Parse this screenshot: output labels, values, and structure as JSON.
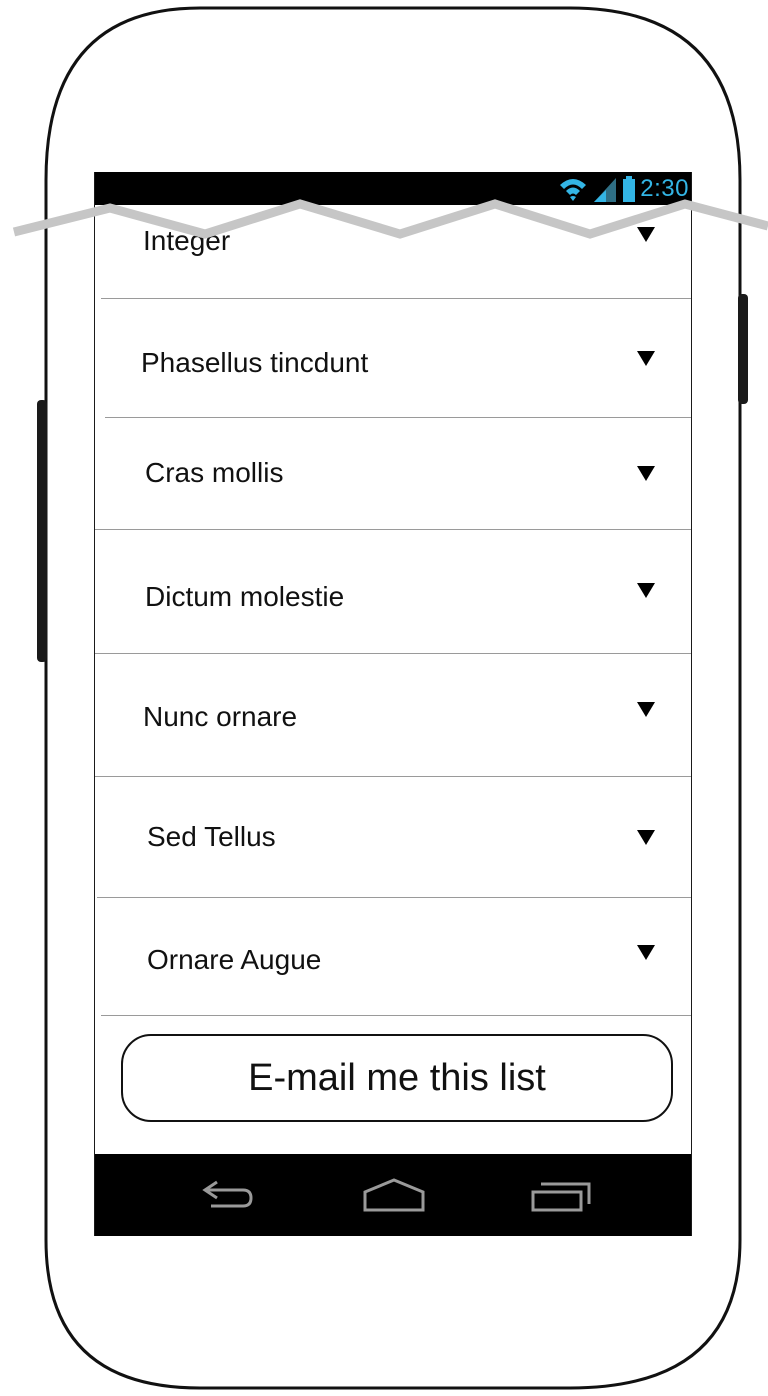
{
  "status_bar": {
    "time": "2:30",
    "accent_color": "#33b5e5",
    "icons": [
      "wifi-icon",
      "signal-icon",
      "battery-icon"
    ]
  },
  "list": {
    "items": [
      {
        "label": "Integer"
      },
      {
        "label": "Phasellus tincdunt"
      },
      {
        "label": "Cras mollis"
      },
      {
        "label": "Dictum molestie"
      },
      {
        "label": "Nunc ornare"
      },
      {
        "label": "Sed Tellus"
      },
      {
        "label": "Ornare Augue"
      }
    ],
    "expand_icon": "dropdown-triangle-icon"
  },
  "actions": {
    "email_label": "E-mail me this list"
  },
  "nav_bar": {
    "icons": [
      "back-icon",
      "home-icon",
      "recent-apps-icon"
    ]
  }
}
